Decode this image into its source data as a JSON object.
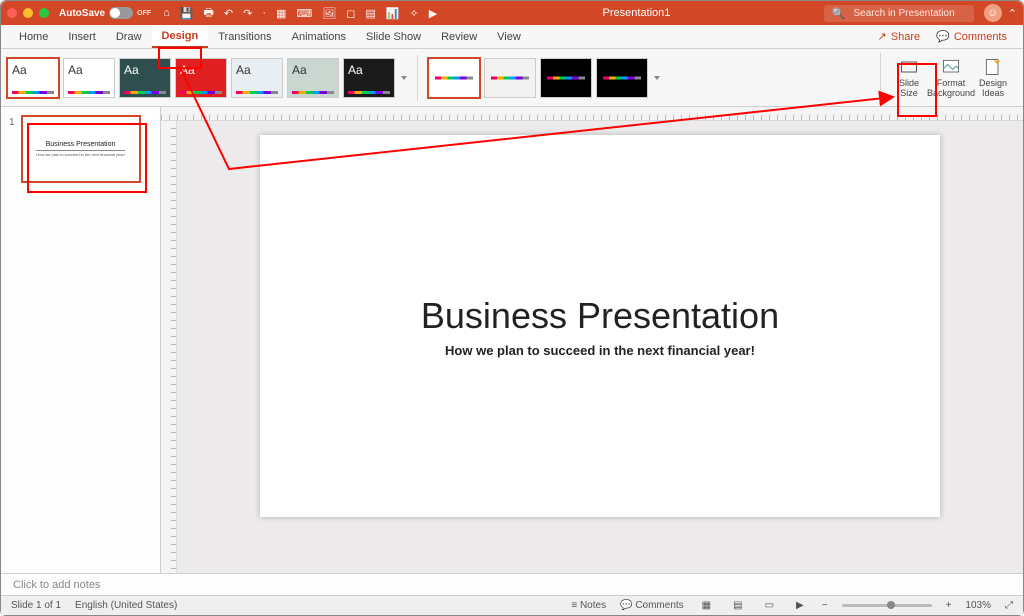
{
  "titlebar": {
    "autosave_label": "AutoSave",
    "autosave_state": "OFF",
    "doc_title": "Presentation1",
    "search_placeholder": "Search in Presentation"
  },
  "tabs": {
    "items": [
      {
        "label": "Home"
      },
      {
        "label": "Insert"
      },
      {
        "label": "Draw"
      },
      {
        "label": "Design"
      },
      {
        "label": "Transitions"
      },
      {
        "label": "Animations"
      },
      {
        "label": "Slide Show"
      },
      {
        "label": "Review"
      },
      {
        "label": "View"
      }
    ],
    "active_index": 3,
    "share_label": "Share",
    "comments_label": "Comments"
  },
  "ribbon": {
    "themes": [
      {
        "aa": "Aa",
        "dark": false,
        "sel": true
      },
      {
        "aa": "Aa",
        "dark": false
      },
      {
        "aa": "Aa",
        "dark": true,
        "bg": "#2f4f4f"
      },
      {
        "aa": "Aa",
        "dark": true,
        "bg": "#e02020"
      },
      {
        "aa": "Aa",
        "dark": false,
        "bg": "#e8eef2"
      },
      {
        "aa": "Aa",
        "dark": false,
        "bg": "#c9d7d0"
      },
      {
        "aa": "Aa",
        "dark": true,
        "bg": "#1b1b1b"
      }
    ],
    "variants": [
      {
        "bg": "#ffffff",
        "sel": true
      },
      {
        "bg": "#f2f2f2"
      },
      {
        "bg": "#000000"
      },
      {
        "bg": "#000000"
      }
    ],
    "slide_size": "Slide\nSize",
    "format_bg": "Format\nBackground",
    "design_ideas": "Design\nIdeas"
  },
  "thumb": {
    "index": "1",
    "title": "Business Presentation",
    "sub": "How we plan to succeed in the next financial year!"
  },
  "slide": {
    "title": "Business Presentation",
    "subtitle": "How we plan to succeed in the next financial year!"
  },
  "notes_placeholder": "Click to add notes",
  "status": {
    "slide_count": "Slide 1 of 1",
    "language": "English (United States)",
    "notes_label": "Notes",
    "comments_label": "Comments",
    "zoom_pct": "103%"
  }
}
